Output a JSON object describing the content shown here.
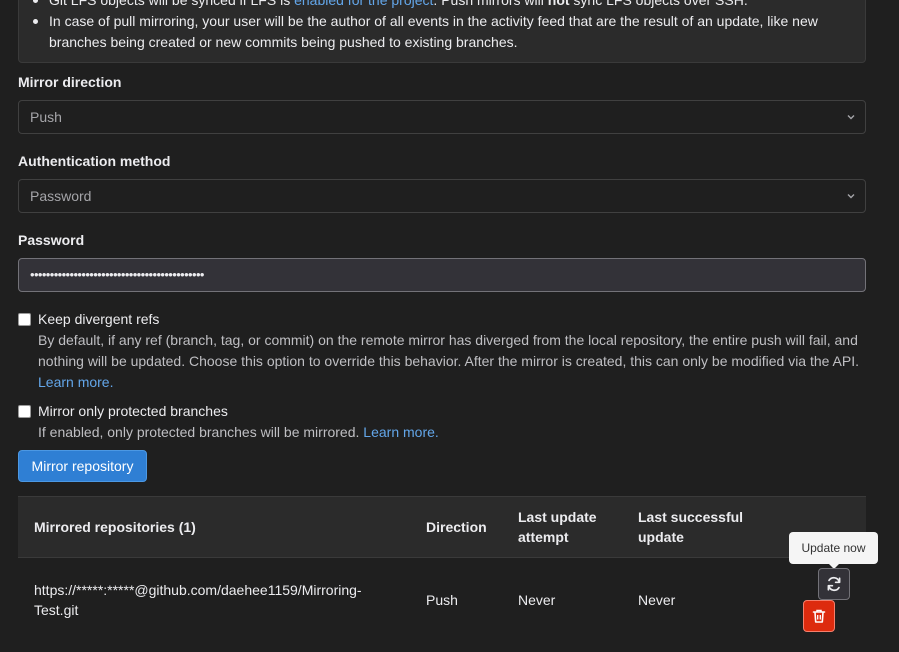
{
  "info": {
    "lfs_prefix": "Git LFS objects will be synced if LFS is ",
    "lfs_link": "enabled for the project",
    "lfs_mid": ". Push mirrors will ",
    "lfs_bold": "not",
    "lfs_suffix": " sync LFS objects over SSH.",
    "pull_note": "In case of pull mirroring, your user will be the author of all events in the activity feed that are the result of an update, like new branches being created or new commits being pushed to existing branches."
  },
  "mirror_direction": {
    "label": "Mirror direction",
    "value": "Push"
  },
  "auth_method": {
    "label": "Authentication method",
    "value": "Password"
  },
  "password": {
    "label": "Password",
    "value": "••••••••••••••••••••••••••••••••••••••••••••"
  },
  "keep_divergent": {
    "label": "Keep divergent refs",
    "help": "By default, if any ref (branch, tag, or commit) on the remote mirror has diverged from the local repository, the entire push will fail, and nothing will be updated. Choose this option to override this behavior. After the mirror is created, this can only be modified via the API.",
    "learn_more": "Learn more."
  },
  "protected_only": {
    "label": "Mirror only protected branches",
    "help": "If enabled, only protected branches will be mirrored.",
    "learn_more": "Learn more."
  },
  "submit_label": "Mirror repository",
  "table": {
    "headers": {
      "repos": "Mirrored repositories (1)",
      "direction": "Direction",
      "last_attempt_1": "Last update",
      "last_attempt_2": "attempt",
      "last_success_1": "Last successful",
      "last_success_2": "update"
    },
    "rows": [
      {
        "url_1": "https://*****:*****@github.com/daehee1159/Mirroring-",
        "url_2": "Test.git",
        "direction": "Push",
        "last_attempt": "Never",
        "last_success": "Never"
      }
    ]
  },
  "tooltip": "Update now",
  "icons": {
    "chevron": "chevron-down-icon",
    "update": "retry-icon",
    "delete": "trash-icon"
  },
  "colors": {
    "link": "#63a6e9",
    "primary": "#1f75cb",
    "danger": "#dd2b0e"
  }
}
